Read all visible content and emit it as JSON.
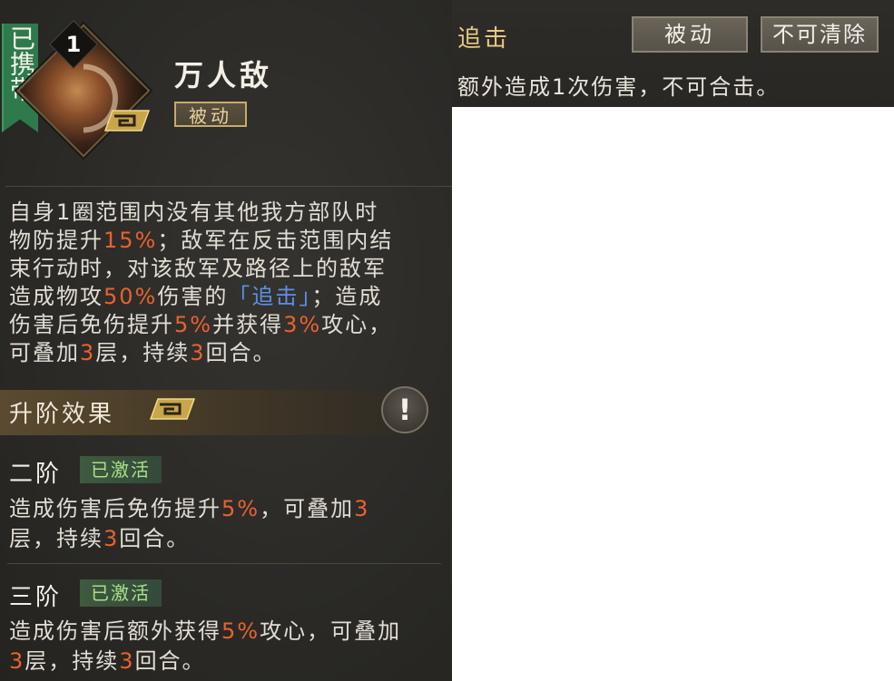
{
  "skill": {
    "carried_label": "已携带",
    "level": "1",
    "name": "万人敌",
    "type_tag": "被动",
    "icon": "warrior-horse-icon"
  },
  "description": {
    "lines": [
      [
        {
          "t": "自身1圈范围内没有其他我方部队时"
        }
      ],
      [
        {
          "t": "物防提升"
        },
        {
          "t": "15%",
          "c": "num"
        },
        {
          "t": "；敌军在反击范围内结"
        }
      ],
      [
        {
          "t": "束行动时，对该敌军及路径上的敌军"
        }
      ],
      [
        {
          "t": "造成物攻"
        },
        {
          "t": "50%",
          "c": "num"
        },
        {
          "t": "伤害的"
        },
        {
          "t": "「追击」",
          "c": "link"
        },
        {
          "t": "；造成"
        }
      ],
      [
        {
          "t": "伤害后免伤提升"
        },
        {
          "t": "5%",
          "c": "num"
        },
        {
          "t": "并获得"
        },
        {
          "t": "3%",
          "c": "num"
        },
        {
          "t": "攻心，"
        }
      ],
      [
        {
          "t": "可叠加"
        },
        {
          "t": "3",
          "c": "num"
        },
        {
          "t": "层，持续"
        },
        {
          "t": "3",
          "c": "num"
        },
        {
          "t": "回合。"
        }
      ]
    ]
  },
  "upgrade": {
    "title": "升阶效果",
    "info_glyph": "!",
    "tiers": [
      {
        "title": "二阶",
        "status": "已激活",
        "lines": [
          [
            {
              "t": "造成伤害后免伤提升"
            },
            {
              "t": "5%",
              "c": "num"
            },
            {
              "t": "，可叠加"
            },
            {
              "t": "3",
              "c": "num"
            }
          ],
          [
            {
              "t": "层，持续"
            },
            {
              "t": "3",
              "c": "num"
            },
            {
              "t": "回合。"
            }
          ]
        ]
      },
      {
        "title": "三阶",
        "status": "已激活",
        "lines": [
          [
            {
              "t": "造成伤害后额外获得"
            },
            {
              "t": "5%",
              "c": "num"
            },
            {
              "t": "攻心，可叠加"
            }
          ],
          [
            {
              "t": "3",
              "c": "num"
            },
            {
              "t": "层，持续"
            },
            {
              "t": "3",
              "c": "num"
            },
            {
              "t": "回合。"
            }
          ]
        ]
      }
    ]
  },
  "pursuit": {
    "title": "追击",
    "tag_passive": "被动",
    "tag_uncleansable": "不可清除",
    "description": "额外造成1次伤害，不可合击。"
  },
  "colors": {
    "highlight_number": "#e8622e",
    "link_blue": "#5d8fe8",
    "carried_green": "#2f7a4c",
    "active_green": "#a8e08a",
    "gold": "#e7c985"
  }
}
